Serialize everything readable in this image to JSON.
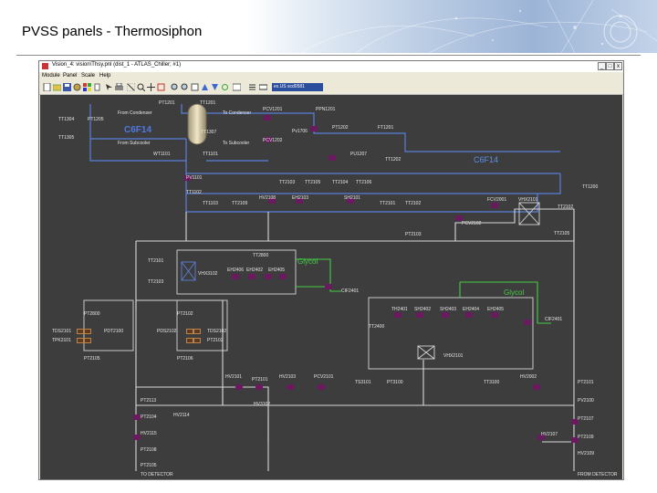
{
  "slide": {
    "title": "PVSS panels - Thermosiphon"
  },
  "window": {
    "title": "Vision_4: vision\\Thsy.pnl (dist_1 - ATLAS_Chiller; #1)",
    "minimize": "_",
    "maximize": "□",
    "close": "x"
  },
  "menu": {
    "items": [
      "Module",
      "Panel",
      "Scale",
      "Help"
    ]
  },
  "toolbar": {
    "panel_select_value": "ex.US scd0581"
  },
  "diagram": {
    "fluids": {
      "c6f14_left": "C6F14",
      "c6f14_right": "C6F14",
      "glycol_1": "Glycol",
      "glycol_2": "Glycol"
    },
    "labels": [
      {
        "id": "PT1201",
        "text": "PT1201"
      },
      {
        "id": "TT1201",
        "text": "TT1201"
      },
      {
        "id": "FromCondenser",
        "text": "From Condenser"
      },
      {
        "id": "ToCondenser",
        "text": "To Condenser"
      },
      {
        "id": "PCV1201",
        "text": "PCV1201"
      },
      {
        "id": "PPN1201",
        "text": "PPN1201"
      },
      {
        "id": "TT1304",
        "text": "TT1304"
      },
      {
        "id": "PT1205",
        "text": "PT1205"
      },
      {
        "id": "PT1202",
        "text": "PT1202"
      },
      {
        "id": "FT1201",
        "text": "FT1201"
      },
      {
        "id": "Pv1706",
        "text": "Pv1706"
      },
      {
        "id": "TT1305",
        "text": "TT1305"
      },
      {
        "id": "TT1307",
        "text": "TT1307"
      },
      {
        "id": "FromSubcooler",
        "text": "From Subcooler"
      },
      {
        "id": "ToSubcooler",
        "text": "To Subcooler"
      },
      {
        "id": "PCV1202",
        "text": "PCV1202"
      },
      {
        "id": "WT1101",
        "text": "WT1101"
      },
      {
        "id": "TT1101",
        "text": "TT1101"
      },
      {
        "id": "PU1207",
        "text": "PU1207"
      },
      {
        "id": "TT1202",
        "text": "TT1202"
      },
      {
        "id": "PV1101",
        "text": "PV1101"
      },
      {
        "id": "TT1102",
        "text": "TT1102"
      },
      {
        "id": "TT1103",
        "text": "TT1103"
      },
      {
        "id": "TT2109",
        "text": "TT2109"
      },
      {
        "id": "TT2103",
        "text": "TT2103"
      },
      {
        "id": "TT2105",
        "text": "TT2105"
      },
      {
        "id": "TT2104",
        "text": "TT2104"
      },
      {
        "id": "TT2106",
        "text": "TT2106"
      },
      {
        "id": "HV2108",
        "text": "HV2108"
      },
      {
        "id": "EH2103",
        "text": "EH2103"
      },
      {
        "id": "SH2101",
        "text": "SH2101"
      },
      {
        "id": "TT2101",
        "text": "TT2101"
      },
      {
        "id": "TT2102",
        "text": "TT2102"
      },
      {
        "id": "FCV2001",
        "text": "FCV2001"
      },
      {
        "id": "VHX2101",
        "text": "VHX2101"
      },
      {
        "id": "TT1200",
        "text": "TT1200"
      },
      {
        "id": "TT2102b",
        "text": "TT2102"
      },
      {
        "id": "PT2103",
        "text": "PT2103"
      },
      {
        "id": "PCV2102",
        "text": "PCV2102"
      },
      {
        "id": "TT2105b",
        "text": "TT2105"
      },
      {
        "id": "TT2800",
        "text": "TT2800"
      },
      {
        "id": "TT2101b",
        "text": "TT2101"
      },
      {
        "id": "EH2406",
        "text": "EH2406"
      },
      {
        "id": "EH2402",
        "text": "EH2402"
      },
      {
        "id": "EH2405",
        "text": "EH2405"
      },
      {
        "id": "VHX3102",
        "text": "VHX3102"
      },
      {
        "id": "TT2103b",
        "text": "TT2103"
      },
      {
        "id": "CIF2401",
        "text": "CIF2401"
      },
      {
        "id": "PT2800",
        "text": "PT2800"
      },
      {
        "id": "PT2102",
        "text": "PT2102"
      },
      {
        "id": "TDS2101",
        "text": "TDS2101"
      },
      {
        "id": "PDT2100",
        "text": "PDT2100"
      },
      {
        "id": "TDS2102",
        "text": "TDS2102"
      },
      {
        "id": "TPK2101",
        "text": "TPK2101"
      },
      {
        "id": "PDS2102",
        "text": "PDS2102"
      },
      {
        "id": "PT2102b",
        "text": "PT2102"
      },
      {
        "id": "PT2105",
        "text": "PT2105"
      },
      {
        "id": "PT2106",
        "text": "PT2106"
      },
      {
        "id": "TH2401",
        "text": "TH2401"
      },
      {
        "id": "SH2402",
        "text": "SH2402"
      },
      {
        "id": "SH2403",
        "text": "SH2403"
      },
      {
        "id": "EH2404",
        "text": "EH2404"
      },
      {
        "id": "EH2405b",
        "text": "EH2405"
      },
      {
        "id": "CIF2401b",
        "text": "CIF2401"
      },
      {
        "id": "TT2400",
        "text": "TT2400"
      },
      {
        "id": "VHX2101b",
        "text": "VHX2101"
      },
      {
        "id": "HV2101",
        "text": "HV2101"
      },
      {
        "id": "PT2101",
        "text": "PT2101"
      },
      {
        "id": "HV2103",
        "text": "HV2103"
      },
      {
        "id": "PCV2101",
        "text": "PCV2101"
      },
      {
        "id": "TS3101",
        "text": "TS3101"
      },
      {
        "id": "PT3100",
        "text": "PT3100"
      },
      {
        "id": "TT3100",
        "text": "TT3100"
      },
      {
        "id": "HV2002",
        "text": "HV2002"
      },
      {
        "id": "PT2101b",
        "text": "PT2101"
      },
      {
        "id": "HV3102",
        "text": "HV3102"
      },
      {
        "id": "PT2113",
        "text": "PT2113"
      },
      {
        "id": "HV2114",
        "text": "HV2114"
      },
      {
        "id": "PT2104",
        "text": "PT2104"
      },
      {
        "id": "HV2115",
        "text": "HV2115"
      },
      {
        "id": "PT2108",
        "text": "PT2108"
      },
      {
        "id": "PT2105b",
        "text": "PT2105"
      },
      {
        "id": "PV2100",
        "text": "PV2100"
      },
      {
        "id": "PT2107",
        "text": "PT2107"
      },
      {
        "id": "HV2107",
        "text": "HV2107"
      },
      {
        "id": "PT2109",
        "text": "PT2109"
      },
      {
        "id": "HV2109",
        "text": "HV2109"
      },
      {
        "id": "ToDetector",
        "text": "TO DETECTOR"
      },
      {
        "id": "FromDetector",
        "text": "FROM DETECTOR"
      }
    ],
    "colors": {
      "pipe_c6f14": "#5a7fd8",
      "pipe_glycol": "#44cc44",
      "pipe_white": "#d8d8d8",
      "device": "#6a1a5e",
      "background": "#3d3d3d"
    }
  }
}
